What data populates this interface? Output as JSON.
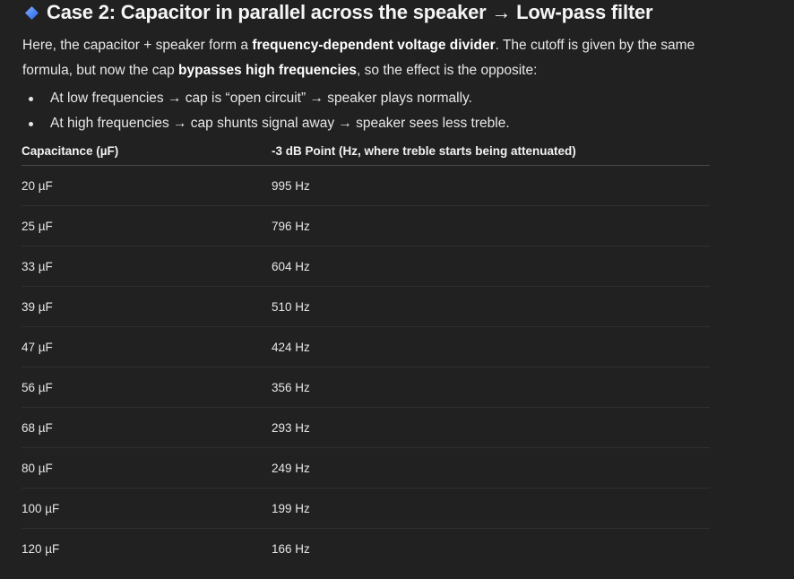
{
  "heading": {
    "icon": "blue-diamond-icon",
    "text": "Case 2: Capacitor in parallel across the speaker → Low-pass filter"
  },
  "paragraph": {
    "part1": "Here, the capacitor + speaker form a ",
    "bold1": "frequency-dependent voltage divider",
    "part2": ". The cutoff is given by the same formula, but now the cap ",
    "bold2": "bypasses high frequencies",
    "part3": ", so the effect is the opposite:"
  },
  "bullets": [
    "At low frequencies → cap is “open circuit” → speaker plays normally.",
    "At high frequencies → cap shunts signal away → speaker sees less treble."
  ],
  "table": {
    "headers": [
      "Capacitance (µF)",
      "-3 dB Point (Hz, where treble starts being attenuated)"
    ],
    "rows": [
      [
        "20 µF",
        "995 Hz"
      ],
      [
        "25 µF",
        "796 Hz"
      ],
      [
        "33 µF",
        "604 Hz"
      ],
      [
        "39 µF",
        "510 Hz"
      ],
      [
        "47 µF",
        "424 Hz"
      ],
      [
        "56 µF",
        "356 Hz"
      ],
      [
        "68 µF",
        "293 Hz"
      ],
      [
        "80 µF",
        "249 Hz"
      ],
      [
        "100 µF",
        "199 Hz"
      ],
      [
        "120 µF",
        "166 Hz"
      ]
    ]
  },
  "colors": {
    "background": "#212121",
    "text": "#ececec",
    "diamond": "#3b82f6"
  }
}
